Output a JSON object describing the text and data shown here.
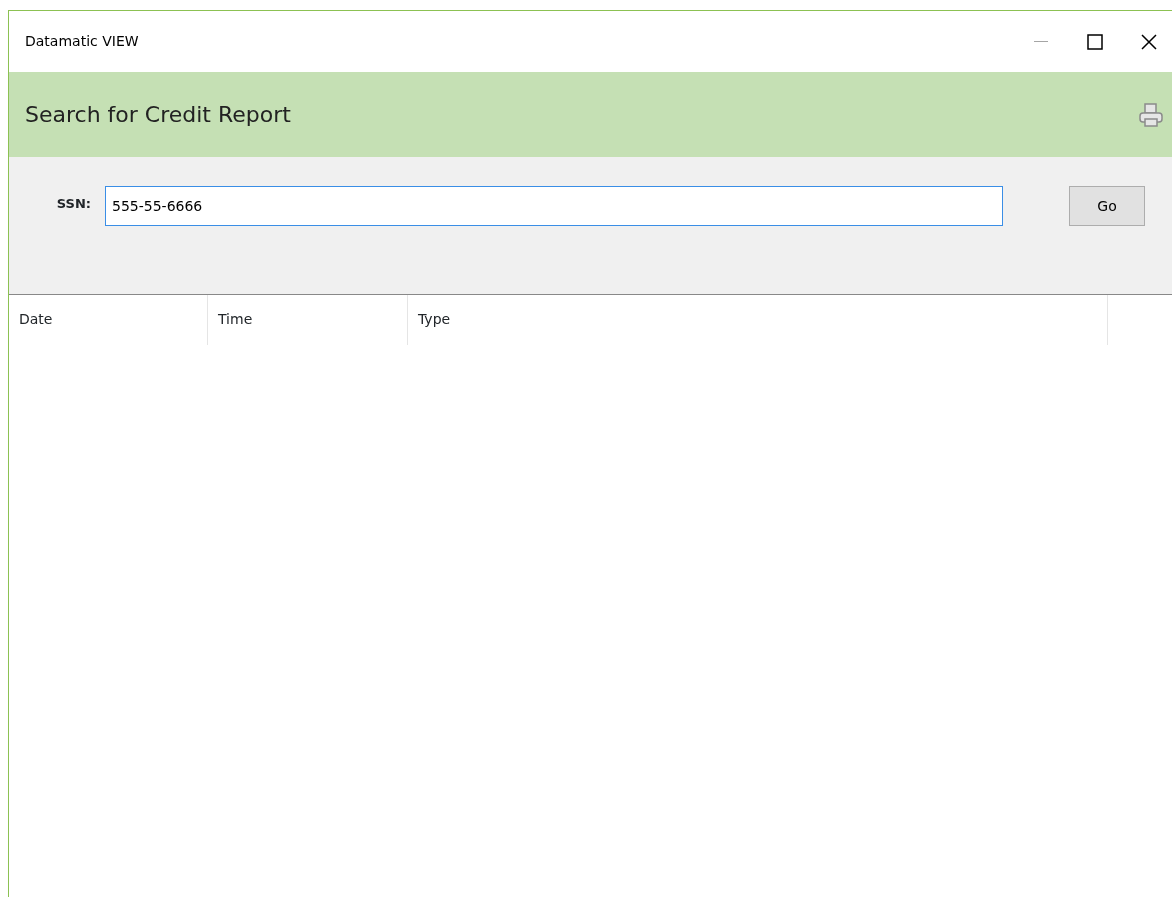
{
  "window": {
    "title": "Datamatic VIEW",
    "minimize_disabled": true
  },
  "header": {
    "title": "Search for Credit Report"
  },
  "search": {
    "label": "SSN:",
    "value": "555-55-6666",
    "button": "Go"
  },
  "table": {
    "columns": [
      "Date",
      "Time",
      "Type"
    ]
  }
}
